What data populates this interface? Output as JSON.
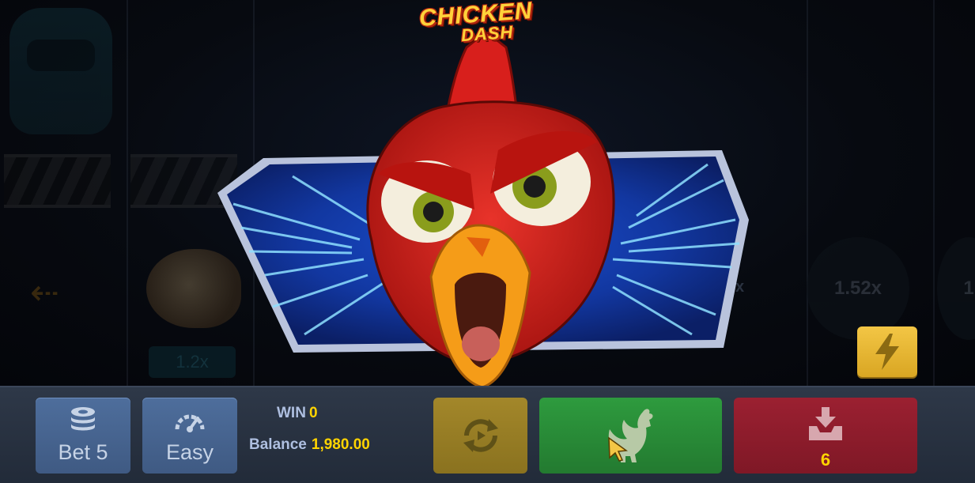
{
  "logo": {
    "line1": "CHICKEN",
    "line2": "DASH"
  },
  "background": {
    "lane_multiplier": "1.2x",
    "multiplier_center": "1.52x",
    "multiplier_edge": "1",
    "stray_x": "x"
  },
  "toolbar": {
    "bet_label": "Bet 5",
    "difficulty_label": "Easy",
    "win_label": "WIN",
    "win_value": "0",
    "balance_label": "Balance",
    "balance_value": "1,980.00",
    "cashout_value": "6"
  },
  "icons": {
    "bet": "coin-stack-icon",
    "difficulty": "speedometer-icon",
    "autoplay": "autoplay-arrows-icon",
    "go": "rooster-icon",
    "cashout": "download-tray-icon",
    "turbo": "lightning-icon"
  },
  "colors": {
    "accent_value": "#ffd400",
    "panel_blue": "#4e6e9c",
    "autoplay_gold": "#a3872a",
    "go_green": "#2e9b3e",
    "cashout_red": "#9b2031",
    "turbo_yellow": "#f3c645"
  }
}
